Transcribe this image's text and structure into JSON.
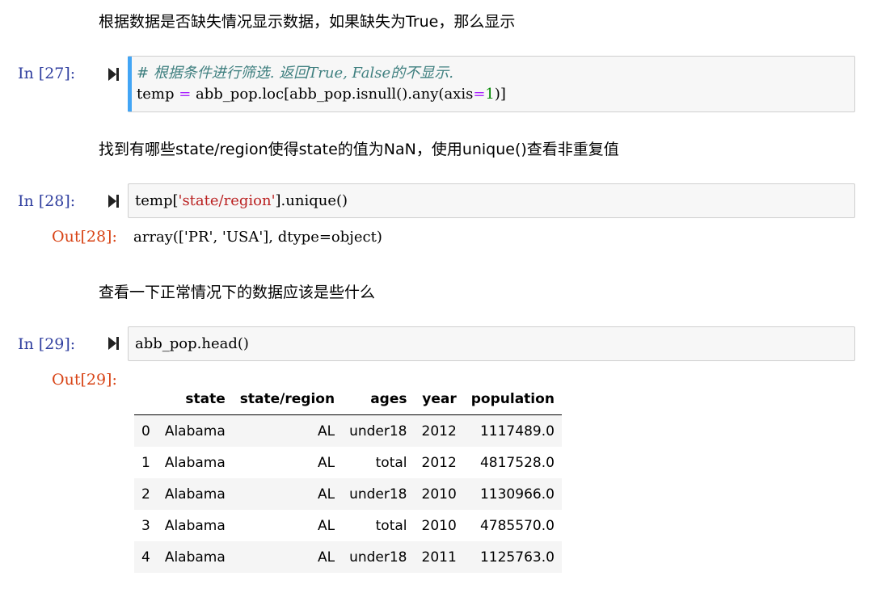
{
  "md1": "根据数据是否缺失情况显示数据，如果缺失为True，那么显示",
  "cell27": {
    "prompt": "In [27]:",
    "comment": "# 根据条件进行筛选. 返回True, False的不显示.",
    "line2_a": "temp ",
    "line2_op": "=",
    "line2_b": " abb_pop.loc[abb_pop.isnull().any(axis",
    "line2_op2": "=",
    "line2_num": "1",
    "line2_c": ")]"
  },
  "md2": "找到有哪些state/region使得state的值为NaN，使用unique()查看非重复值",
  "cell28": {
    "prompt": "In [28]:",
    "code_a": "temp[",
    "code_str": "'state/region'",
    "code_b": "].unique()",
    "out_prompt": "Out[28]:",
    "output": "array(['PR', 'USA'], dtype=object)"
  },
  "md3": "查看一下正常情况下的数据应该是些什么",
  "cell29": {
    "prompt": "In [29]:",
    "code": "abb_pop.head()",
    "out_prompt": "Out[29]:"
  },
  "table": {
    "columns": [
      "",
      "state",
      "state/region",
      "ages",
      "year",
      "population"
    ],
    "rows": [
      [
        "0",
        "Alabama",
        "AL",
        "under18",
        "2012",
        "1117489.0"
      ],
      [
        "1",
        "Alabama",
        "AL",
        "total",
        "2012",
        "4817528.0"
      ],
      [
        "2",
        "Alabama",
        "AL",
        "under18",
        "2010",
        "1130966.0"
      ],
      [
        "3",
        "Alabama",
        "AL",
        "total",
        "2010",
        "4785570.0"
      ],
      [
        "4",
        "Alabama",
        "AL",
        "under18",
        "2011",
        "1125763.0"
      ]
    ]
  },
  "icons": {
    "run": "run-cell-icon"
  },
  "colors": {
    "prompt_in": "#303f9f",
    "prompt_out": "#d84315",
    "comment": "#408080",
    "string": "#ba2121",
    "operator": "#aa22ff",
    "number": "#008800",
    "active_cell_bar": "#42a5f5"
  }
}
